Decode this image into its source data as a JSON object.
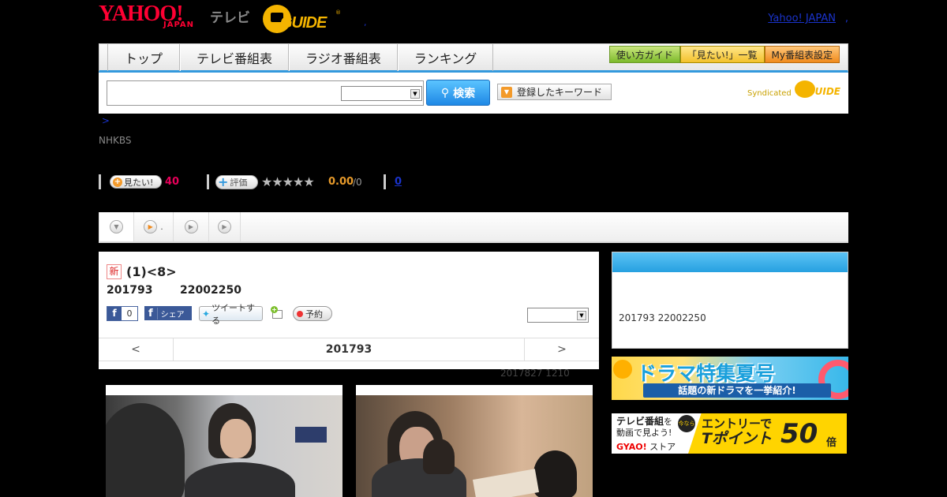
{
  "header": {
    "logo_yahoo": "YAHOO!",
    "logo_japan": "JAPAN",
    "logo_tv": "テレビ",
    "logo_gguide": "GUIDE",
    "yahoo_japan_link": "Yahoo! JAPAN",
    "link_sep": ","
  },
  "nav": {
    "tabs": [
      {
        "label": "トップ"
      },
      {
        "label": "テレビ番組表"
      },
      {
        "label": "ラジオ番組表"
      },
      {
        "label": "ランキング"
      }
    ],
    "buttons": [
      {
        "label": "使い方ガイド"
      },
      {
        "label": "「見たい!」一覧"
      },
      {
        "label": "My番組表設定"
      }
    ]
  },
  "search": {
    "placeholder": "",
    "button_label": "検索",
    "keyword_button": "登録したキーワード",
    "syndicated": "Syndicated"
  },
  "breadcrumb": {
    "sep": ">"
  },
  "program": {
    "channel": "NHKBS",
    "new_badge": "新",
    "title": "(1)<8>",
    "date": "201793",
    "time": "22002250",
    "mitai_label": "見たい!",
    "mitai_count": "40",
    "hyoka_label": "評価",
    "rating_stars": 0,
    "score": "0.00",
    "score_of": "/0",
    "review_count": "0",
    "fb_count": "0",
    "fb_share": "シェア",
    "tweet": "ツイートする",
    "reserve": "予約",
    "nav_prev": "<",
    "nav_current": "201793",
    "nav_next": ">",
    "updated": "2017827  1210"
  },
  "tabs": {
    "items": [
      {
        "icon": "chevron-down-icon",
        "label": ""
      },
      {
        "icon": "play-icon",
        "label": "."
      },
      {
        "icon": "play-icon",
        "label": ""
      },
      {
        "icon": "play-icon",
        "label": ""
      }
    ]
  },
  "sidebar": {
    "info": "201793  22002250",
    "banner1_title": "ドラマ特集夏号",
    "banner1_sub": "話題の新ドラマを一挙紹介!",
    "banner2_left1": "テレビ番組",
    "banner2_left1b": "を",
    "banner2_left2": "動画で見よう!",
    "banner2_gyao": "GYAO!",
    "banner2_store": " ストア",
    "banner2_imanara": "今なら",
    "banner2_entry": "エントリーで",
    "banner2_tpoint": "Tポイント",
    "banner2_fifty": "50",
    "banner2_bai": "倍"
  },
  "colors": {
    "accent_blue": "#3399dd",
    "brand_red": "#ff0033",
    "gguide_yellow": "#f4b400",
    "count_pink": "#e8005a",
    "score_orange": "#e89b2b"
  }
}
